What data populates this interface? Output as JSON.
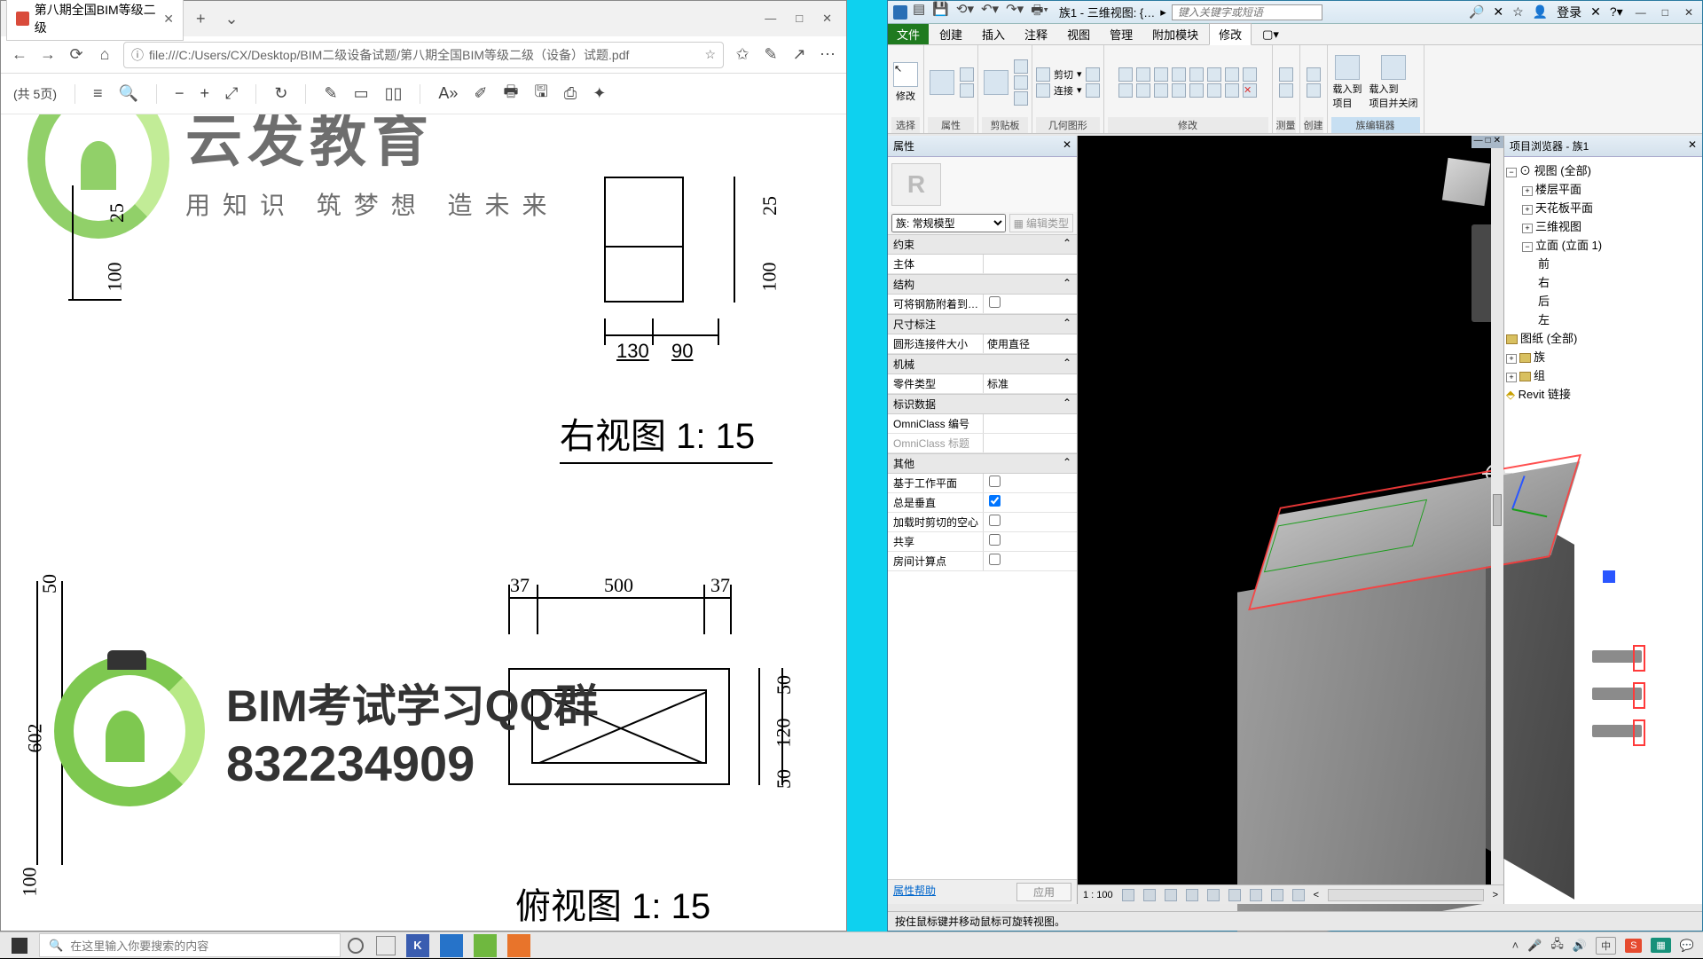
{
  "browser": {
    "tab_title": "第八期全国BIM等级二级",
    "url": "file:///C:/Users/CX/Desktop/BIM二级设备试题/第八期全国BIM等级二级（设备）试题.pdf",
    "page_info": "(共 5页)",
    "win": {
      "min": "—",
      "max": "□",
      "close": "✕"
    }
  },
  "watermark": {
    "company": "云发教育",
    "slogan": "用知识 筑梦想 造未来",
    "qq_label": "BIM考试学习QQ群",
    "qq_number": "832234909"
  },
  "drawing": {
    "right_view": "右视图  1: 15",
    "top_view": "俯视图  1: 15",
    "d25": "25",
    "d100a": "100",
    "d100b": "100",
    "d130": "130",
    "d90": "90",
    "d50t": "50",
    "d50a": "50",
    "d50b": "50",
    "d602": "602",
    "d37a": "37",
    "d37b": "37",
    "d500": "500",
    "d120": "120"
  },
  "revit": {
    "doc": "族1 - 三维视图: {…",
    "search_ph": "键入关键字或短语",
    "login": "登录",
    "menu": {
      "file": "文件",
      "create": "创建",
      "insert": "插入",
      "annotate": "注释",
      "view": "视图",
      "manage": "管理",
      "addins": "附加模块",
      "modify": "修改"
    },
    "ribbon": {
      "select": "选择",
      "modify_btn": "修改",
      "properties": "属性",
      "clipboard": "剪贴板",
      "cut": "剪切",
      "join": "连接",
      "geometry": "几何图形",
      "modify": "修改",
      "measure": "测量",
      "create": "创建",
      "load_proj": "载入到\n项目",
      "load_proj_close": "载入到\n项目并关闭",
      "fameditor": "族编辑器"
    },
    "props": {
      "title": "属性",
      "famtype": "族: 常规模型",
      "edit_type": "编辑类型",
      "g_constraint": "约束",
      "host": "主体",
      "g_struct": "结构",
      "rebar_attach": "可将钢筋附着到…",
      "g_dim": "尺寸标注",
      "round_conn": "圆形连接件大小",
      "round_conn_v": "使用直径",
      "g_mech": "机械",
      "part_type": "零件类型",
      "part_type_v": "标准",
      "g_id": "标识数据",
      "omni_num": "OmniClass 编号",
      "omni_title": "OmniClass 标题",
      "g_other": "其他",
      "workplane": "基于工作平面",
      "always_vert": "总是垂直",
      "cut_void": "加载时剪切的空心",
      "shared": "共享",
      "room_calc": "房间计算点",
      "help": "属性帮助",
      "apply": "应用"
    },
    "browser": {
      "title": "项目浏览器 - 族1",
      "views": "视图 (全部)",
      "floor": "楼层平面",
      "ceiling": "天花板平面",
      "threeD": "三维视图",
      "elev": "立面 (立面 1)",
      "front": "前",
      "right": "右",
      "back": "后",
      "left": "左",
      "sheets": "图纸 (全部)",
      "families": "族",
      "groups": "组",
      "links": "Revit 链接"
    },
    "viewbar": {
      "scale": "1 : 100"
    },
    "status": "按住鼠标键并移动鼠标可旋转视图。"
  },
  "taskbar": {
    "search_ph": "在这里输入你要搜索的内容",
    "ime": "中",
    "sogou": "S"
  }
}
